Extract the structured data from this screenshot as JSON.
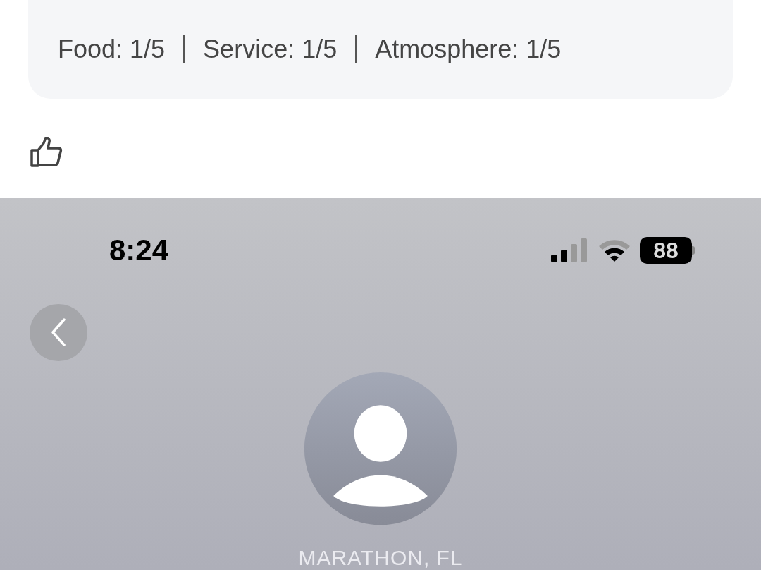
{
  "ratings": [
    {
      "label": "Food:",
      "value": "1/5"
    },
    {
      "label": "Service:",
      "value": "1/5"
    },
    {
      "label": "Atmosphere:",
      "value": "1/5"
    }
  ],
  "like": {
    "selected": false
  },
  "status_bar": {
    "time": "8:24",
    "battery": "88"
  },
  "profile": {
    "location": "MARATHON, FL"
  }
}
